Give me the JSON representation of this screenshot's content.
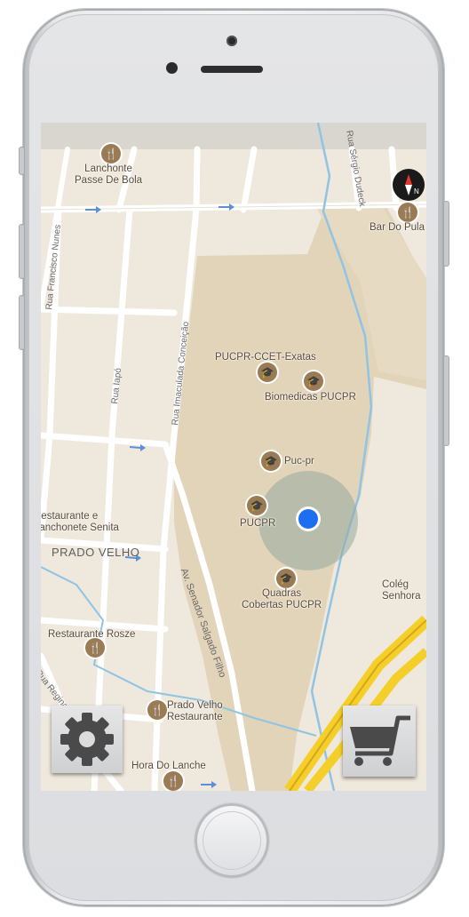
{
  "map": {
    "places": [
      {
        "name": "Lanchonte\nPasse De Bola",
        "kind": "restaurant"
      },
      {
        "name": "Bar Do Pula",
        "kind": "restaurant"
      },
      {
        "name": "PUCPR-CCET-Exatas",
        "kind": "education"
      },
      {
        "name": "Biomedicas PUCPR",
        "kind": "education"
      },
      {
        "name": "Puc-pr",
        "kind": "education"
      },
      {
        "name": "PUCPR",
        "kind": "education"
      },
      {
        "name": "Quadras\nCobertas PUCPR",
        "kind": "education"
      },
      {
        "name": "Restaurante e\nLanchonete Senita",
        "kind": "restaurant"
      },
      {
        "name": "Restaurante Rosze",
        "kind": "restaurant"
      },
      {
        "name": "Prado Velho\nRestaurante",
        "kind": "restaurant"
      },
      {
        "name": "Hora Do Lanche",
        "kind": "restaurant"
      },
      {
        "name": "Colég\nSenhora",
        "kind": "education"
      }
    ],
    "region_label": "PRADO VELHO",
    "streets": {
      "rua_francisco_nunes": "Rua Francisco Nunes",
      "rua_sergio_dudeck": "Rua Sérgio Dudeck",
      "rua_lapo": "Rua Iapó",
      "rua_imaculada": "Rua Imaculada Conceição",
      "av_senador": "Av. Senador Salgado Filho",
      "rua_regina": "Rua Regina Ce"
    },
    "compass_label": "N"
  },
  "controls": {
    "settings_icon": "gear-icon",
    "cart_icon": "shopping-cart-icon"
  },
  "colors": {
    "map_background": "#efe8dc",
    "campus": "#e0d2b6",
    "road": "#ffffff",
    "highway": "#f4cf2a",
    "water": "#8fc4e4",
    "user_location": "#1e6ef0"
  }
}
